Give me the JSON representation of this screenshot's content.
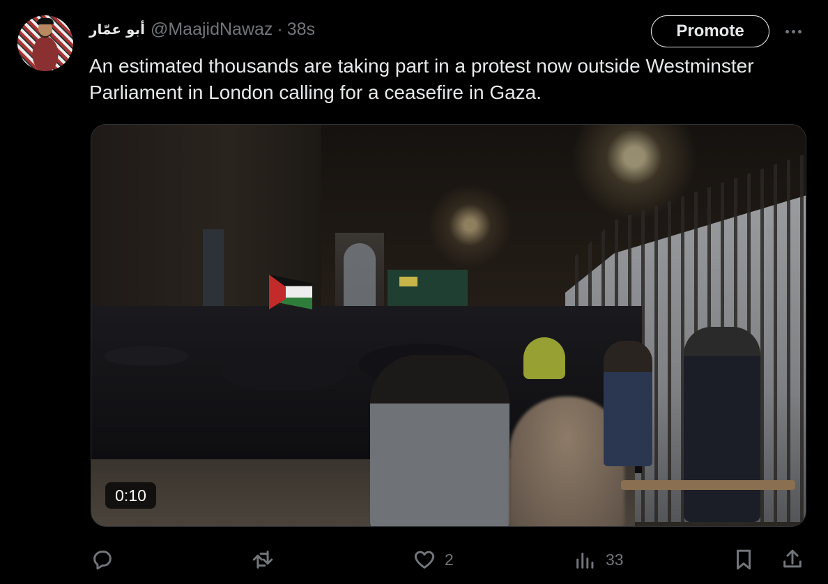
{
  "tweet": {
    "display_name": "أبو عمّار",
    "handle": "@MaajidNawaz",
    "separator": "·",
    "time": "38s",
    "text": "An estimated thousands are taking part in a protest now outside Westminster Parliament in London calling for a ceasefire in Gaza.",
    "video_duration": "0:10"
  },
  "buttons": {
    "promote_label": "Promote",
    "more_icon": "more-horizontal-icon"
  },
  "actions": {
    "reply": {
      "icon": "reply-icon",
      "count": ""
    },
    "repost": {
      "icon": "repost-icon",
      "count": ""
    },
    "like": {
      "icon": "heart-icon",
      "count": "2"
    },
    "views": {
      "icon": "analytics-icon",
      "count": "33"
    },
    "bookmark": {
      "icon": "bookmark-icon",
      "count": ""
    },
    "share": {
      "icon": "share-icon",
      "count": ""
    }
  },
  "colors": {
    "background": "#000000",
    "text_primary": "#e7e9ea",
    "text_secondary": "#71767b",
    "border": "#2f3336"
  }
}
